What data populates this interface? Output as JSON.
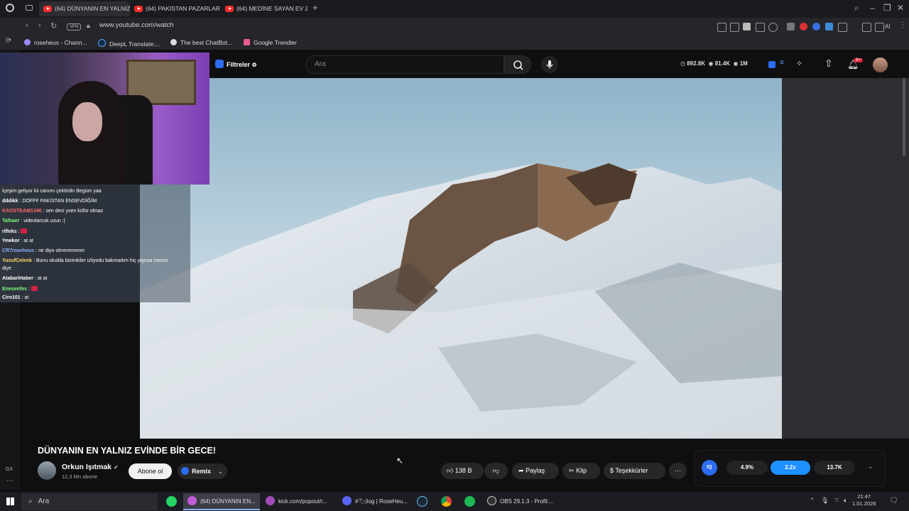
{
  "browser": {
    "tabs": [
      {
        "label": "(64) DÜNYANIN EN YALNIZ",
        "active": true
      },
      {
        "label": "(64) PAKİSTAN PAZARLAR",
        "active": false
      },
      {
        "label": "(64) MEDİNE SAYAN EV Z",
        "active": false
      }
    ],
    "vpn": "VPN",
    "url": "www.youtube.com/watch",
    "ai_label": "AI",
    "bookmarks": [
      "roseheus - Chann...",
      "DeepL Translate:...",
      "The best ChatBot...",
      "Google Trendler"
    ]
  },
  "chat": [
    {
      "user": "",
      "text": "İçeşim geliyor kii canımı çektirdin Begüm yaa",
      "color": "#ffffff"
    },
    {
      "user": "dddikk",
      "text": "DOFFF PAKİSTAN ENSEVDİĞİM",
      "color": "#ffffff"
    },
    {
      "user": "KAOSTEAM1346",
      "text": "sen deci ysen küfür olmaz",
      "color": "#ff6b6b"
    },
    {
      "user": "Talhaer",
      "text": "videolarcok uzun :(",
      "color": "#7cfc7c"
    },
    {
      "user": "rifleks",
      "text": "",
      "color": "#ffffff"
    },
    {
      "user": "Yewkor",
      "text": "at at",
      "color": "#ffffff"
    },
    {
      "user": "CR7roseheus",
      "text": "ne diyo olmmmmmm",
      "color": "#8ab4ff"
    },
    {
      "user": "YusufCelenk",
      "text": "Bunu okulda bizimkiler izliyodu bakmadım hiç yayına mecez",
      "color": "#ffd966"
    },
    {
      "user": "",
      "text": "diye",
      "color": "#ffffff"
    },
    {
      "user": "AtabariHaber",
      "text": "at at",
      "color": "#ffffff"
    },
    {
      "user": "Enesenfes",
      "text": "",
      "color": "#7cfc7c"
    },
    {
      "user": "Ciro101",
      "text": "at",
      "color": "#ffffff"
    }
  ],
  "youtube": {
    "filters_label": "Filtreler",
    "search_placeholder": "Ara",
    "stats": {
      "views": "892.8K",
      "watch": "81.4K",
      "subs": "1M"
    },
    "notif_badge": "9+",
    "video_title": "DÜNYANIN EN YALNIZ EVİNDE BİR GECE!",
    "channel_name": "Orkun Işıtmak",
    "channel_subs": "12,3 Mn abone",
    "subscribe_label": "Abone ol",
    "remix_label": "Remix",
    "like_count": "138 B",
    "share_label": "Paylaş",
    "clip_label": "Klip",
    "thanks_label": "Teşekkürler",
    "iq_values": [
      "4.9%",
      "2.2x",
      "13.7K"
    ],
    "iq_badge": "IQ"
  },
  "sidebar": {
    "gx_label": "GX"
  },
  "taskbar": {
    "search_label": "Ara",
    "apps": [
      {
        "label": "(64) DÜNYANIN EN...",
        "active": true,
        "color": "#c25bd6"
      },
      {
        "label": "kick.com/popout/r...",
        "active": false,
        "color": "#c25bd6"
      },
      {
        "label": "#🏷|log | RoseHeu...",
        "active": false,
        "color": "#5865f2"
      },
      {
        "label": "OBS 29.1.3 - Profil:...",
        "active": false,
        "color": "#444444"
      }
    ],
    "time": "21:47",
    "date": "1.01.2026"
  }
}
